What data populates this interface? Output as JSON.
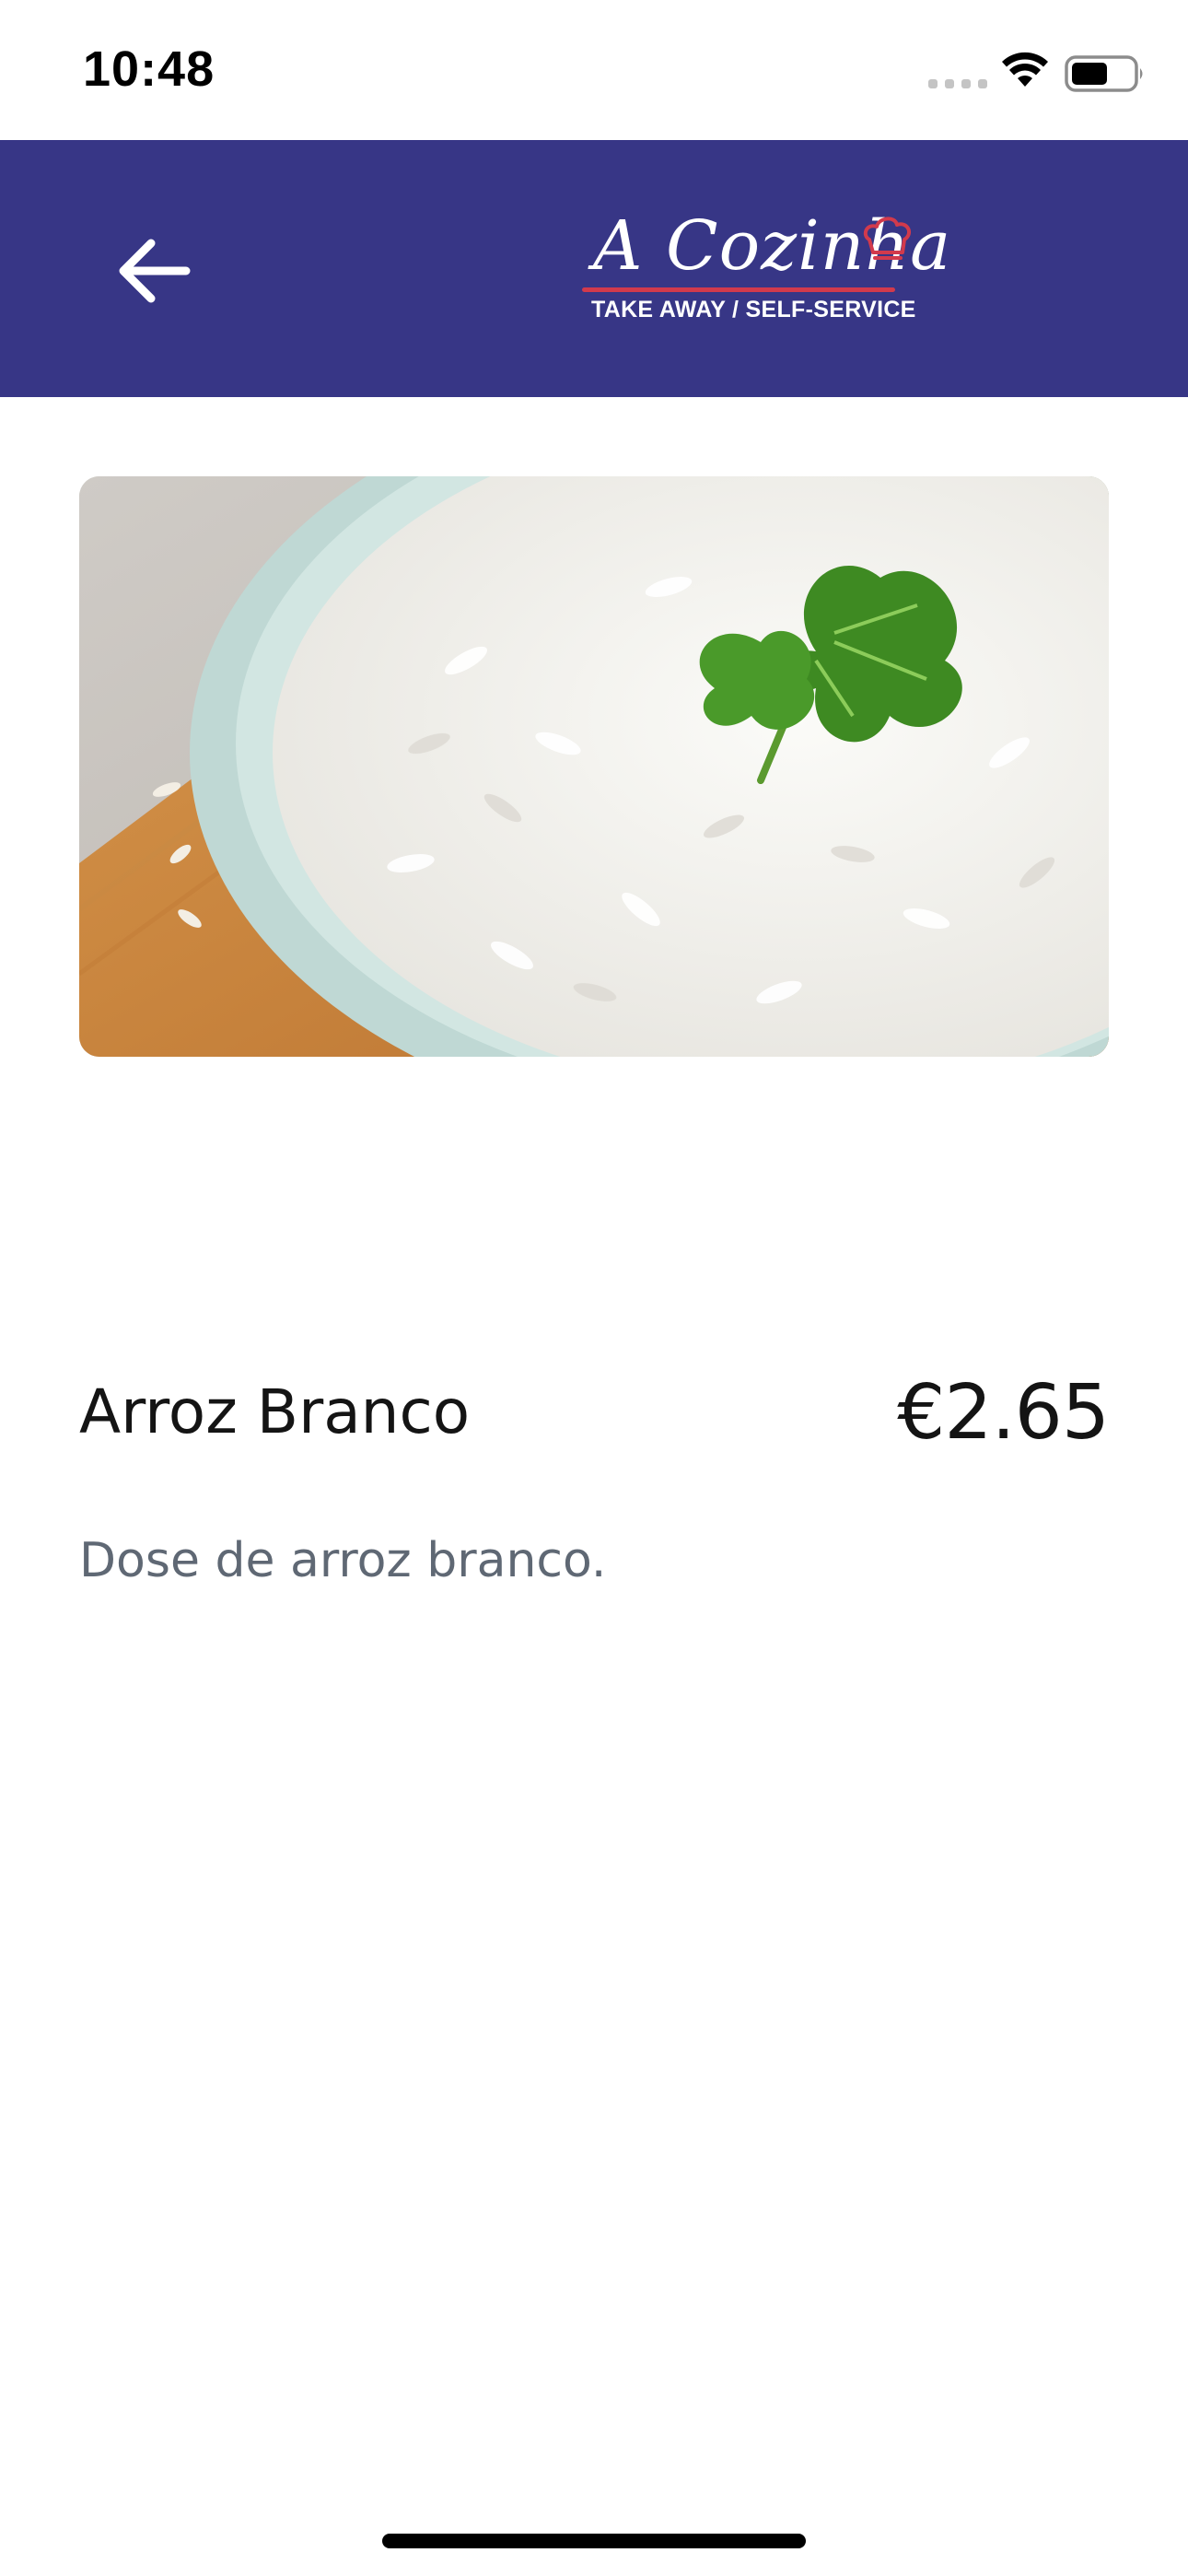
{
  "status_bar": {
    "time": "10:48",
    "icons": [
      "signal-icon",
      "wifi-icon",
      "battery-icon"
    ]
  },
  "header": {
    "background_color": "#373686",
    "back_icon": "arrow-left-icon",
    "logo": {
      "title": "A Cozinha",
      "subtitle": "TAKE AWAY  /  SELF-SERVICE",
      "accent_color": "#d23a4c",
      "icon": "chef-hat-icon"
    }
  },
  "product": {
    "image_subject": "bowl of white rice with parsley",
    "name": "Arroz Branco",
    "price": "€2.65",
    "description": "Dose de arroz branco."
  },
  "colors": {
    "text_primary": "#141414",
    "text_secondary": "#5f6874"
  }
}
